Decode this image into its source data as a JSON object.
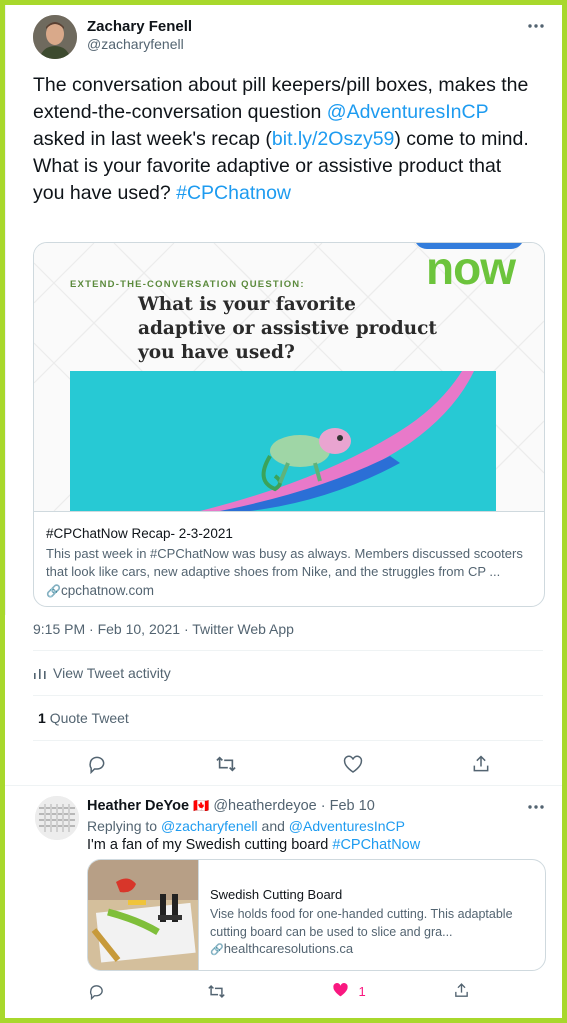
{
  "main_tweet": {
    "author_name": "Zachary Fenell",
    "author_handle": "@zacharyfenell",
    "text_1": "The conversation about pill keepers/pill boxes, makes the extend-the-conversation question ",
    "mention": "@AdventuresInCP",
    "text_2": " asked in last week's recap (",
    "short_link": "bit.ly/2Oszy59",
    "text_3": ") come to mind. What is your favorite adaptive or assistive product that you have used? ",
    "hashtag": "#CPChatnow",
    "card": {
      "logo_text": "now",
      "eyebrow": "EXTEND-THE-CONVERSATION QUESTION:",
      "question": "What is your favorite adaptive or assistive product you have used?",
      "title": "#CPChatNow Recap- 2-3-2021",
      "description": "This past week in #CPChatNow was busy as always. Members discussed scooters that look like cars, new adaptive shoes from Nike, and the struggles from CP ...",
      "domain": "cpchatnow.com"
    },
    "timestamp": "9:15 PM · Feb 10, 2021 · Twitter Web App",
    "activity_label": "View Tweet activity",
    "quote_count": "1",
    "quote_label": "Quote Tweet"
  },
  "reply": {
    "author_name": "Heather DeYoe",
    "flag": "🇨🇦",
    "handle_date": "@heatherdeyoe · Feb 10",
    "replying_prefix": "Replying to ",
    "replying_user1": "@zacharyfenell",
    "replying_and": " and ",
    "replying_user2": "@AdventuresInCP",
    "text": "I'm a fan of my Swedish cutting board ",
    "hashtag": "#CPChatNow",
    "card": {
      "title": "Swedish Cutting Board",
      "description": "Vise holds food for one-handed cutting. This adaptable cutting board can be used to slice and gra...",
      "domain": "healthcaresolutions.ca"
    },
    "like_count": "1"
  },
  "colors": {
    "border": "#a8d82c",
    "link": "#1d9bf0",
    "like": "#f91880",
    "card_teal": "#27c9d4"
  }
}
